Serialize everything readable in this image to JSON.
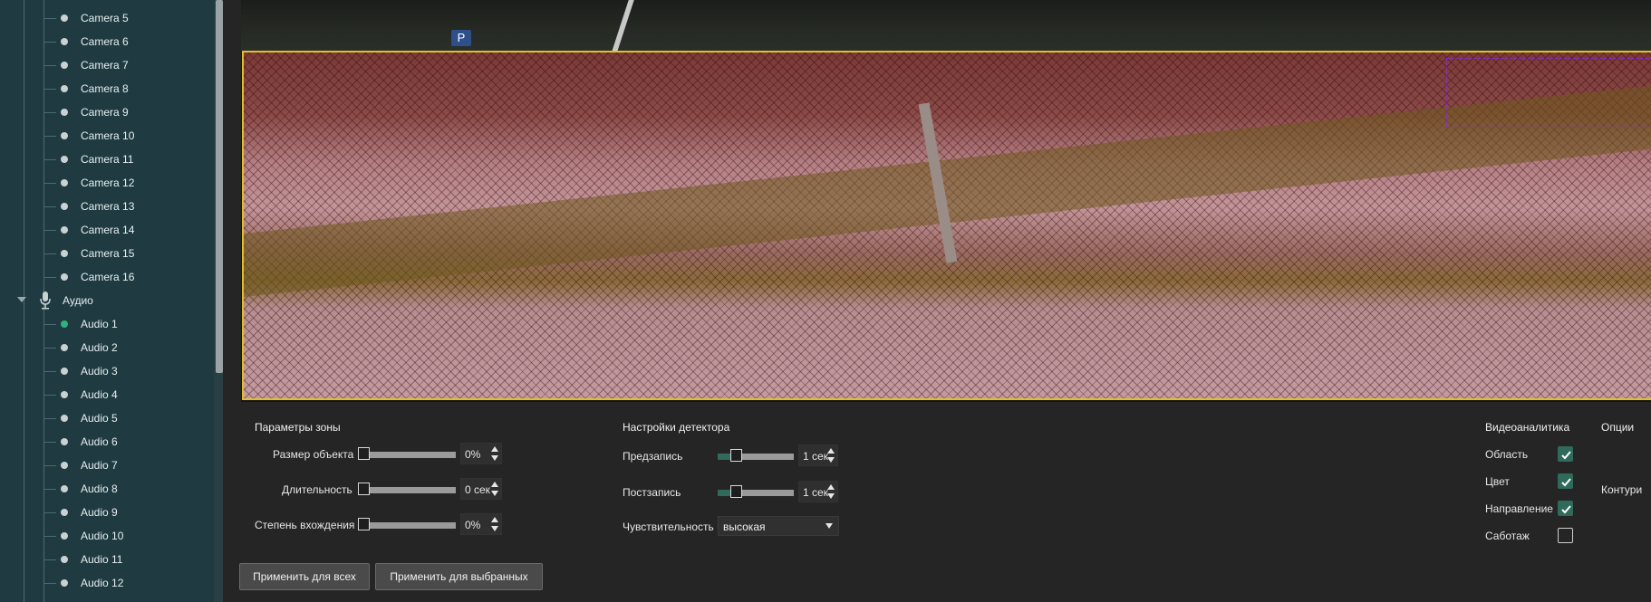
{
  "sidebar": {
    "cameras": [
      "Camera 5",
      "Camera 6",
      "Camera 7",
      "Camera 8",
      "Camera 9",
      "Camera 10",
      "Camera 11",
      "Camera 12",
      "Camera 13",
      "Camera 14",
      "Camera 15",
      "Camera 16"
    ],
    "audio_group": "Аудио",
    "audio": [
      "Audio 1",
      "Audio 2",
      "Audio 3",
      "Audio 4",
      "Audio 5",
      "Audio 6",
      "Audio 7",
      "Audio 8",
      "Audio 9",
      "Audio 10",
      "Audio 11",
      "Audio 12"
    ],
    "active_audio_index": 0
  },
  "video": {
    "sign": "P"
  },
  "zone_params": {
    "title": "Параметры зоны",
    "object_size": {
      "label": "Размер объекта",
      "value": "0%"
    },
    "duration": {
      "label": "Длительность",
      "value": "0 сек"
    },
    "entry_degree": {
      "label": "Степень вхождения",
      "value": "0%"
    }
  },
  "detector": {
    "title": "Настройки детектора",
    "prerecord": {
      "label": "Предзапись",
      "value": "1 сек"
    },
    "postrecord": {
      "label": "Постзапись",
      "value": "1 сек"
    },
    "sensitivity": {
      "label": "Чувствительность",
      "value": "высокая"
    }
  },
  "analytics": {
    "title": "Видеоаналитика",
    "items": [
      {
        "label": "Область",
        "checked": true
      },
      {
        "label": "Цвет",
        "checked": true
      },
      {
        "label": "Направление",
        "checked": true
      },
      {
        "label": "Саботаж",
        "checked": false
      }
    ]
  },
  "options": {
    "title": "Опции",
    "contour_label": "Контури"
  },
  "buttons": {
    "apply_all": "Применить для всех",
    "apply_selected": "Применить для выбранных"
  },
  "colors": {
    "accent": "#2f6a5b",
    "zone_border": "#e0c02a",
    "sidebar_bg": "#1f3b41",
    "active_dot": "#2fb37a"
  }
}
